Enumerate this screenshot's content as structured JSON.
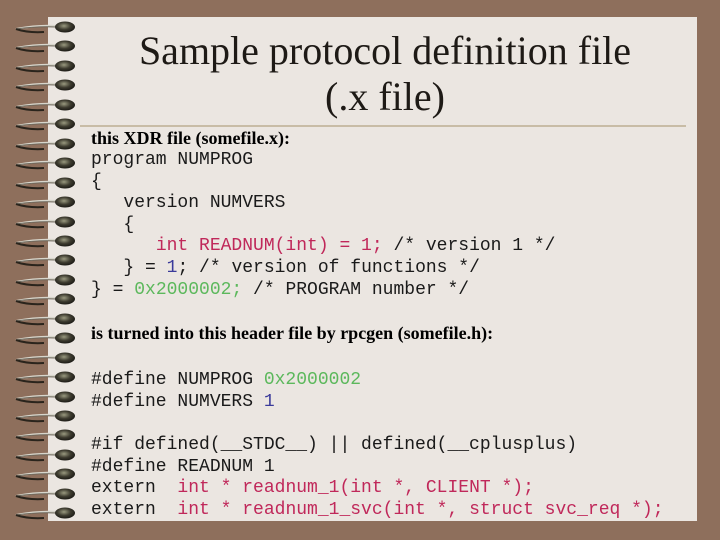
{
  "slide": {
    "title_line1": "Sample protocol definition file",
    "title_line2": "(.x file)",
    "colors": {
      "background": "#8e6f5c",
      "paper": "#ebe6e1",
      "keyword_red": "#c0285a",
      "number_blue": "#3a3a9a",
      "hex_green": "#5cb85c"
    },
    "spiral_ring_count": 26,
    "section1": {
      "heading": "this XDR file (somefile.x):",
      "lines": [
        [
          {
            "t": "program NUMPROG",
            "c": ""
          }
        ],
        [
          {
            "t": "{",
            "c": ""
          }
        ],
        [
          {
            "t": "   version NUMVERS",
            "c": ""
          }
        ],
        [
          {
            "t": "   {",
            "c": ""
          }
        ],
        [
          {
            "t": "      ",
            "c": ""
          },
          {
            "t": "int READNUM(int) = 1;",
            "c": "red"
          },
          {
            "t": " /* version 1 */",
            "c": ""
          }
        ],
        [
          {
            "t": "   } = ",
            "c": ""
          },
          {
            "t": "1",
            "c": "blue"
          },
          {
            "t": "; /* version of functions */",
            "c": ""
          }
        ],
        [
          {
            "t": "} = ",
            "c": ""
          },
          {
            "t": "0x2000002;",
            "c": "green"
          },
          {
            "t": " /* PROGRAM number */",
            "c": ""
          }
        ]
      ]
    },
    "section2": {
      "heading": "is turned into this header file by rpcgen (somefile.h):",
      "block1": [
        [
          {
            "t": "#define NUMPROG ",
            "c": ""
          },
          {
            "t": "0x2000002",
            "c": "green"
          }
        ],
        [
          {
            "t": "#define NUMVERS ",
            "c": ""
          },
          {
            "t": "1",
            "c": "blue"
          }
        ]
      ],
      "block2": [
        [
          {
            "t": "#if defined(__STDC__) || defined(__cplusplus)",
            "c": ""
          }
        ],
        [
          {
            "t": "#define READNUM 1",
            "c": ""
          }
        ],
        [
          {
            "t": "extern  ",
            "c": ""
          },
          {
            "t": "int * readnum_1(int *, CLIENT *);",
            "c": "red"
          }
        ],
        [
          {
            "t": "extern  ",
            "c": ""
          },
          {
            "t": "int * readnum_1_svc(int *, struct svc_req *);",
            "c": "red"
          }
        ]
      ]
    }
  }
}
